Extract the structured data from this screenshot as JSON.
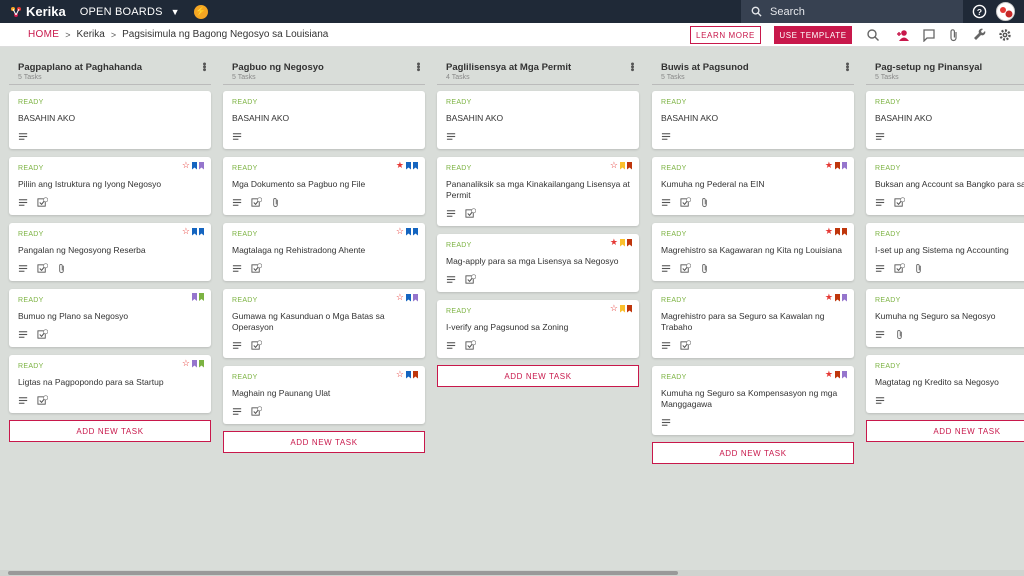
{
  "app": {
    "name": "Kerika",
    "open_boards": "OPEN BOARDS",
    "search_placeholder": "Search"
  },
  "breadcrumb": {
    "home": "HOME",
    "org": "Kerika",
    "board": "Pagsisimula ng Bagong Negosyo sa Louisiana"
  },
  "actions": {
    "learn_more": "LEARN MORE",
    "use_template": "USE TEMPLATE"
  },
  "colors": {
    "accent": "#c8184b",
    "ready": "#7cb342",
    "topbar": "#1f2937"
  },
  "columns": [
    {
      "title": "Pagpaplano at Paghahanda",
      "count": "5 Tasks",
      "add_label": "ADD NEW TASK",
      "cards": [
        {
          "status": "READY",
          "title": "BASAHIN AKO",
          "icons": [
            "desc"
          ],
          "flags": []
        },
        {
          "status": "READY",
          "title": "Piliin ang Istruktura ng Iyong Negosyo",
          "icons": [
            "desc",
            "check"
          ],
          "check_count": "2",
          "flags": [
            "star-outline",
            "blue",
            "purple"
          ]
        },
        {
          "status": "READY",
          "title": "Pangalan ng Negosyong Reserba",
          "icons": [
            "desc",
            "check",
            "attach"
          ],
          "check_count": "2",
          "flags": [
            "star-outline",
            "blue",
            "blue"
          ]
        },
        {
          "status": "READY",
          "title": "Bumuo ng Plano sa Negosyo",
          "icons": [
            "desc",
            "check"
          ],
          "check_count": "2",
          "flags": [
            "purple",
            "green"
          ]
        },
        {
          "status": "READY",
          "title": "Ligtas na Pagpopondo para sa Startup",
          "icons": [
            "desc",
            "check"
          ],
          "check_count": "2",
          "flags": [
            "star-outline",
            "purple",
            "green"
          ]
        }
      ]
    },
    {
      "title": "Pagbuo ng Negosyo",
      "count": "5 Tasks",
      "add_label": "ADD NEW TASK",
      "cards": [
        {
          "status": "READY",
          "title": "BASAHIN AKO",
          "icons": [
            "desc"
          ],
          "flags": []
        },
        {
          "status": "READY",
          "title": "Mga Dokumento sa Pagbuo ng File",
          "icons": [
            "desc",
            "check",
            "attach"
          ],
          "check_count": "2",
          "flags": [
            "star",
            "blue",
            "blue"
          ]
        },
        {
          "status": "READY",
          "title": "Magtalaga ng Rehistradong Ahente",
          "icons": [
            "desc",
            "check"
          ],
          "check_count": "1",
          "flags": [
            "star-outline",
            "blue",
            "blue"
          ]
        },
        {
          "status": "READY",
          "title": "Gumawa ng Kasunduan o Mga Batas sa Operasyon",
          "icons": [
            "desc",
            "check"
          ],
          "check_count": "1",
          "flags": [
            "star-outline",
            "blue",
            "purple"
          ]
        },
        {
          "status": "READY",
          "title": "Maghain ng Paunang Ulat",
          "icons": [
            "desc",
            "check"
          ],
          "check_count": "2",
          "flags": [
            "star-outline",
            "blue",
            "brown"
          ]
        }
      ]
    },
    {
      "title": "Paglilisensya at Mga Permit",
      "count": "4 Tasks",
      "add_label": "ADD NEW TASK",
      "cards": [
        {
          "status": "READY",
          "title": "BASAHIN AKO",
          "icons": [
            "desc"
          ],
          "flags": []
        },
        {
          "status": "READY",
          "title": "Pananaliksik sa mga Kinakailangang Lisensya at Permit",
          "icons": [
            "desc",
            "check"
          ],
          "check_count": "1",
          "flags": [
            "star-outline",
            "yellow",
            "brown"
          ]
        },
        {
          "status": "READY",
          "title": "Mag-apply para sa mga Lisensya sa Negosyo",
          "icons": [
            "desc",
            "check"
          ],
          "check_count": "1",
          "flags": [
            "star",
            "yellow",
            "brown"
          ]
        },
        {
          "status": "READY",
          "title": "I-verify ang Pagsunod sa Zoning",
          "icons": [
            "desc",
            "check"
          ],
          "check_count": "1",
          "flags": [
            "star-outline",
            "yellow",
            "brown"
          ]
        }
      ]
    },
    {
      "title": "Buwis at Pagsunod",
      "count": "5 Tasks",
      "add_label": "ADD NEW TASK",
      "cards": [
        {
          "status": "READY",
          "title": "BASAHIN AKO",
          "icons": [
            "desc"
          ],
          "flags": []
        },
        {
          "status": "READY",
          "title": "Kumuha ng Pederal na EIN",
          "icons": [
            "desc",
            "check",
            "attach"
          ],
          "check_count": "2",
          "flags": [
            "star",
            "brown",
            "purple"
          ]
        },
        {
          "status": "READY",
          "title": "Magrehistro sa Kagawaran ng Kita ng Louisiana",
          "icons": [
            "desc",
            "check",
            "attach"
          ],
          "check_count": "2",
          "flags": [
            "star",
            "brown",
            "brown"
          ]
        },
        {
          "status": "READY",
          "title": "Magrehistro para sa Seguro sa Kawalan ng Trabaho",
          "icons": [
            "desc",
            "check"
          ],
          "check_count": "1",
          "flags": [
            "star",
            "brown",
            "purple"
          ]
        },
        {
          "status": "READY",
          "title": "Kumuha ng Seguro sa Kompensasyon ng mga Manggagawa",
          "icons": [
            "desc"
          ],
          "flags": [
            "star",
            "brown",
            "purple"
          ]
        }
      ]
    },
    {
      "title": "Pag-setup ng Pinansyal",
      "count": "5 Tasks",
      "add_label": "ADD NEW TASK",
      "cards": [
        {
          "status": "READY",
          "title": "BASAHIN AKO",
          "icons": [
            "desc"
          ],
          "flags": []
        },
        {
          "status": "READY",
          "title": "Buksan ang Account sa Bangko para sa",
          "icons": [
            "desc",
            "check"
          ],
          "check_count": "1",
          "flags": []
        },
        {
          "status": "READY",
          "title": "I-set up ang Sistema ng Accounting",
          "icons": [
            "desc",
            "check",
            "attach"
          ],
          "check_count": "2",
          "flags": []
        },
        {
          "status": "READY",
          "title": "Kumuha ng Seguro sa Negosyo",
          "icons": [
            "desc",
            "attach"
          ],
          "flags": []
        },
        {
          "status": "READY",
          "title": "Magtatag ng Kredito sa Negosyo",
          "icons": [
            "desc"
          ],
          "flags": []
        }
      ]
    }
  ]
}
